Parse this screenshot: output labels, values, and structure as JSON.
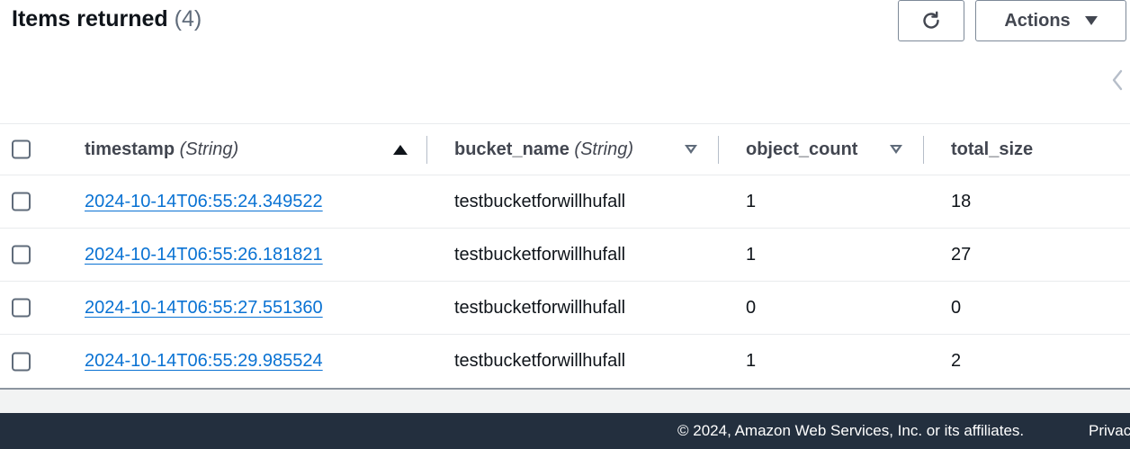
{
  "header": {
    "title": "Items returned",
    "count": "(4)",
    "refresh_icon": "refresh-icon",
    "actions_label": "Actions",
    "pagination_prev_icon": "chevron-left-icon"
  },
  "table": {
    "columns": [
      {
        "name": "timestamp",
        "type": "(String)",
        "sort": "ascending"
      },
      {
        "name": "bucket_name",
        "type": "(String)",
        "sort": "none"
      },
      {
        "name": "object_count",
        "type": "",
        "sort": "none"
      },
      {
        "name": "total_size",
        "type": "",
        "sort": "none"
      }
    ],
    "rows": [
      {
        "timestamp": "2024-10-14T06:55:24.349522",
        "bucket_name": "testbucketforwillhufall",
        "object_count": "1",
        "total_size": "18"
      },
      {
        "timestamp": "2024-10-14T06:55:26.181821",
        "bucket_name": "testbucketforwillhufall",
        "object_count": "1",
        "total_size": "27"
      },
      {
        "timestamp": "2024-10-14T06:55:27.551360",
        "bucket_name": "testbucketforwillhufall",
        "object_count": "0",
        "total_size": "0"
      },
      {
        "timestamp": "2024-10-14T06:55:29.985524",
        "bucket_name": "testbucketforwillhufall",
        "object_count": "1",
        "total_size": "2"
      }
    ]
  },
  "footer": {
    "copyright": "© 2024, Amazon Web Services, Inc. or its affiliates.",
    "privacy": "Privac"
  },
  "colors": {
    "link": "#0972d3",
    "footer_bg": "#232f3e",
    "text": "#0f141a"
  }
}
